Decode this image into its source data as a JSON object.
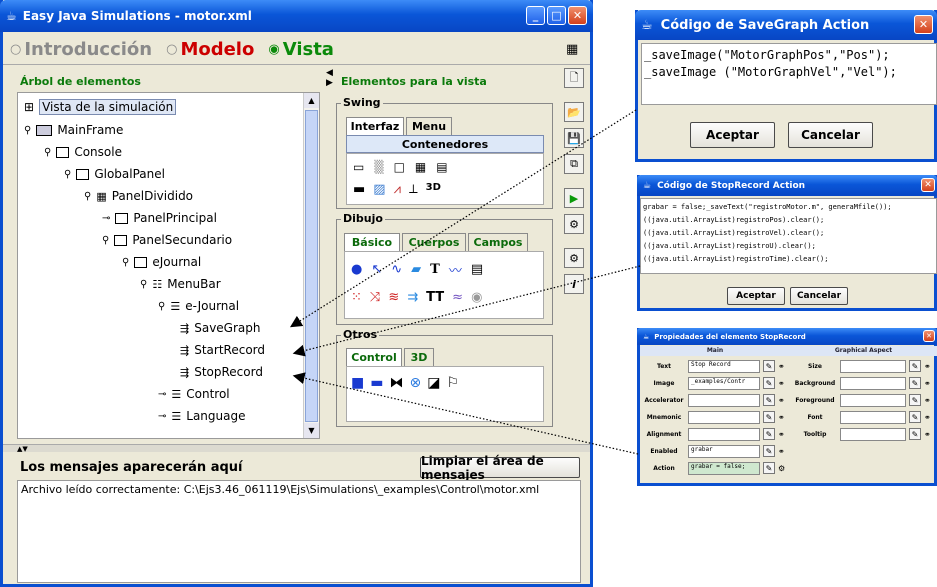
{
  "main_window": {
    "title": "Easy Java Simulations - motor.xml",
    "modes": [
      {
        "label": "Introducción",
        "color": "#8a8a8a",
        "selected": false
      },
      {
        "label": "Modelo",
        "color": "#cc0000",
        "selected": false
      },
      {
        "label": "Vista",
        "color": "#0b8a0b",
        "selected": true
      }
    ],
    "tree_header": "Árbol de elementos",
    "elements_header": "Elementos para la vista",
    "tree": [
      {
        "label": "Vista de la simulación",
        "icon": "view-icon"
      },
      {
        "label": "MainFrame",
        "icon": "frame-icon"
      },
      {
        "label": "Console",
        "icon": "panel-icon"
      },
      {
        "label": "GlobalPanel",
        "icon": "panel-icon"
      },
      {
        "label": "PanelDividido",
        "icon": "split-panel-icon"
      },
      {
        "label": "PanelPrincipal",
        "icon": "panel-icon"
      },
      {
        "label": "PanelSecundario",
        "icon": "panel-icon"
      },
      {
        "label": "eJournal",
        "icon": "panel-icon"
      },
      {
        "label": "MenuBar",
        "icon": "menubar-icon"
      },
      {
        "label": "e-Journal",
        "icon": "menu-icon"
      },
      {
        "label": "SaveGraph",
        "icon": "menu-item-icon"
      },
      {
        "label": "StartRecord",
        "icon": "menu-item-icon"
      },
      {
        "label": "StopRecord",
        "icon": "menu-item-icon"
      },
      {
        "label": "Control",
        "icon": "menu-icon"
      },
      {
        "label": "Language",
        "icon": "menu-icon"
      }
    ],
    "groups": {
      "swing": "Swing",
      "swing_tabs": [
        "Interfaz",
        "Menu"
      ],
      "swing_subtab": "Contenedores",
      "dibujo": "Dibujo",
      "dibujo_tabs": [
        "Básico",
        "Cuerpos",
        "Campos"
      ],
      "otros": "Otros",
      "otros_tabs": [
        "Control",
        "3D"
      ]
    },
    "messages": {
      "header": "Los mensajes aparecerán aquí",
      "clear_button": "Limpiar el área de mensajes",
      "text": "Archivo leído correctamente: C:\\Ejs3.46_061119\\Ejs\\Simulations\\_examples\\Control\\motor.xml"
    }
  },
  "savegraph_dialog": {
    "title": "Código de SaveGraph Action",
    "code": [
      "_saveImage(\"MotorGraphPos\",\"Pos\");",
      "_saveImage (\"MotorGraphVel\",\"Vel\");"
    ],
    "ok": "Aceptar",
    "cancel": "Cancelar"
  },
  "stoprecord_dialog": {
    "title": "Código de StopRecord Action",
    "code": [
      "grabar = false;_saveText(\"registroMotor.m\", generaMfile());",
      "((java.util.ArrayList)registroPos).clear();",
      "((java.util.ArrayList)registroVel).clear();",
      "((java.util.ArrayList)registroU).clear();",
      "((java.util.ArrayList)registroTime).clear();"
    ],
    "ok": "Aceptar",
    "cancel": "Cancelar"
  },
  "props_dialog": {
    "title": "Propiedades del elemento StopRecord",
    "main_header": "Main",
    "graphical_header": "Graphical Aspect",
    "left_rows": [
      {
        "label": "Text",
        "value": "Stop Record"
      },
      {
        "label": "Image",
        "value": "_examples/Contr"
      },
      {
        "label": "Accelerator",
        "value": ""
      },
      {
        "label": "Mnemonic",
        "value": ""
      },
      {
        "label": "Alignment",
        "value": ""
      },
      {
        "label": "Enabled",
        "value": "grabar"
      },
      {
        "label": "Action",
        "value": "grabar = false;"
      }
    ],
    "right_rows": [
      {
        "label": "Size",
        "value": ""
      },
      {
        "label": "Background",
        "value": ""
      },
      {
        "label": "Foreground",
        "value": ""
      },
      {
        "label": "Font",
        "value": ""
      },
      {
        "label": "Tooltip",
        "value": ""
      }
    ]
  }
}
